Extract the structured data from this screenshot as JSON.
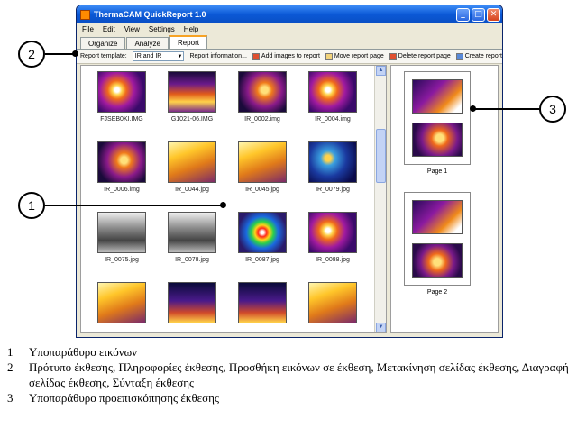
{
  "window": {
    "title": "ThermaCAM QuickReport 1.0",
    "controls": [
      "_",
      "□",
      "✕"
    ]
  },
  "menu": [
    "File",
    "Edit",
    "View",
    "Settings",
    "Help"
  ],
  "tabs": [
    {
      "label": "Organize",
      "active": false
    },
    {
      "label": "Analyze",
      "active": false
    },
    {
      "label": "Report",
      "active": true
    }
  ],
  "toolbar": {
    "template_label": "Report template:",
    "template_value": "IR and IR",
    "report_info": "Report information...",
    "add_images": "Add images to report",
    "move_page": "Move report page",
    "delete_page": "Delete report page",
    "create_report": "Create report"
  },
  "thumbnails": [
    {
      "label": "FJSEB0KI.IMG",
      "style": "ir-purple"
    },
    {
      "label": "G1021-06.IMG",
      "style": "ir-building"
    },
    {
      "label": "IR_0002.img",
      "style": "ir-box"
    },
    {
      "label": "IR_0004.img",
      "style": "ir-purple"
    },
    {
      "label": "IR_0006.img",
      "style": "ir-box"
    },
    {
      "label": "IR_0044.jpg",
      "style": "ir-yellow"
    },
    {
      "label": "IR_0045.jpg",
      "style": "ir-yellow"
    },
    {
      "label": "IR_0079.jpg",
      "style": "ir-blue"
    },
    {
      "label": "IR_0075.jpg",
      "style": "gray"
    },
    {
      "label": "IR_0078.jpg",
      "style": "gray"
    },
    {
      "label": "IR_0087.jpg",
      "style": "ir-rainbow"
    },
    {
      "label": "IR_0088.jpg",
      "style": "ir-purple"
    },
    {
      "label": "",
      "style": "ir-yellow"
    },
    {
      "label": "",
      "style": "ir-dark"
    },
    {
      "label": "",
      "style": "ir-dark"
    },
    {
      "label": "",
      "style": "ir-yellow"
    }
  ],
  "pages": [
    {
      "label": "Page 1"
    },
    {
      "label": "Page 2"
    }
  ],
  "callouts": [
    "1",
    "2",
    "3"
  ],
  "legend": [
    {
      "num": "1",
      "text": "Υποπαράθυρο εικόνων"
    },
    {
      "num": "2",
      "text": "Πρότυπο έκθεσης, Πληροφορίες έκθεσης, Προσθήκη εικόνων σε έκθεση, Μετακίνηση σελίδας έκθεσης, Διαγραφή σελίδας έκθεσης, Σύνταξη έκθεσης"
    },
    {
      "num": "3",
      "text": "Υποπαράθυρο προεπισκόπησης έκθεσης"
    }
  ],
  "colors": {
    "titlebar": "#0b58d6",
    "ir_purple": "#4a1a7a",
    "ir_yellow": "#f2b21a"
  }
}
